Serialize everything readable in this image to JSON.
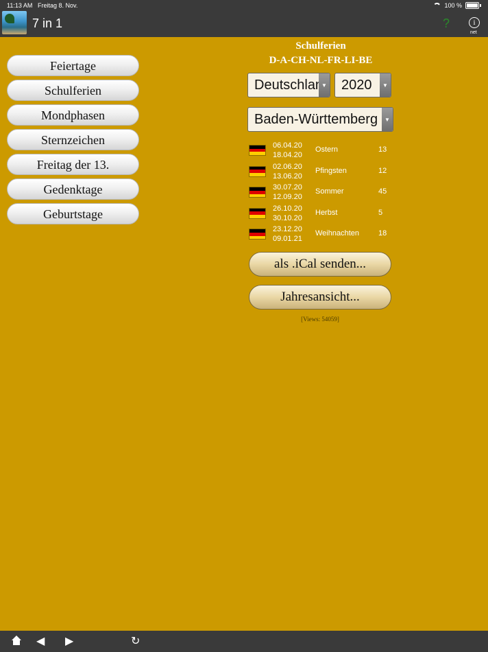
{
  "status": {
    "time": "11:13 AM",
    "date": "Freitag 8. Nov.",
    "battery": "100 %"
  },
  "app": {
    "title": "7 in 1",
    "help_label": "?",
    "info_label": "net"
  },
  "menu": [
    {
      "label": "Feiertage"
    },
    {
      "label": "Schulferien"
    },
    {
      "label": "Mondphasen"
    },
    {
      "label": "Sternzeichen"
    },
    {
      "label": "Freitag der 13."
    },
    {
      "label": "Gedenktage"
    },
    {
      "label": "Geburtstage"
    }
  ],
  "panel": {
    "title_line1": "Schulferien",
    "title_line2": "D-A-CH-NL-FR-LI-BE",
    "country": "Deutschland",
    "year": "2020",
    "state": "Baden-Württemberg",
    "flag_colors": [
      "#000000",
      "#dd0000",
      "#ffce00"
    ]
  },
  "holidays": [
    {
      "start": "06.04.20",
      "end": "18.04.20",
      "name": "Ostern",
      "days": "13"
    },
    {
      "start": "02.06.20",
      "end": "13.06.20",
      "name": "Pfingsten",
      "days": "12"
    },
    {
      "start": "30.07.20",
      "end": "12.09.20",
      "name": "Sommer",
      "days": "45"
    },
    {
      "start": "26.10.20",
      "end": "30.10.20",
      "name": "Herbst",
      "days": "5"
    },
    {
      "start": "23.12.20",
      "end": "09.01.21",
      "name": "Weihnachten",
      "days": "18"
    }
  ],
  "buttons": {
    "ical": "als .iCal senden...",
    "year_view": "Jahresansicht..."
  },
  "views": "[Views: 54059]",
  "toolbar": {
    "home_icon": "home-icon",
    "back_icon": "back-icon",
    "forward_icon": "forward-icon",
    "reload_icon": "reload-icon"
  },
  "colors": {
    "background": "#cc9a00",
    "bar": "#3a3a3a"
  }
}
